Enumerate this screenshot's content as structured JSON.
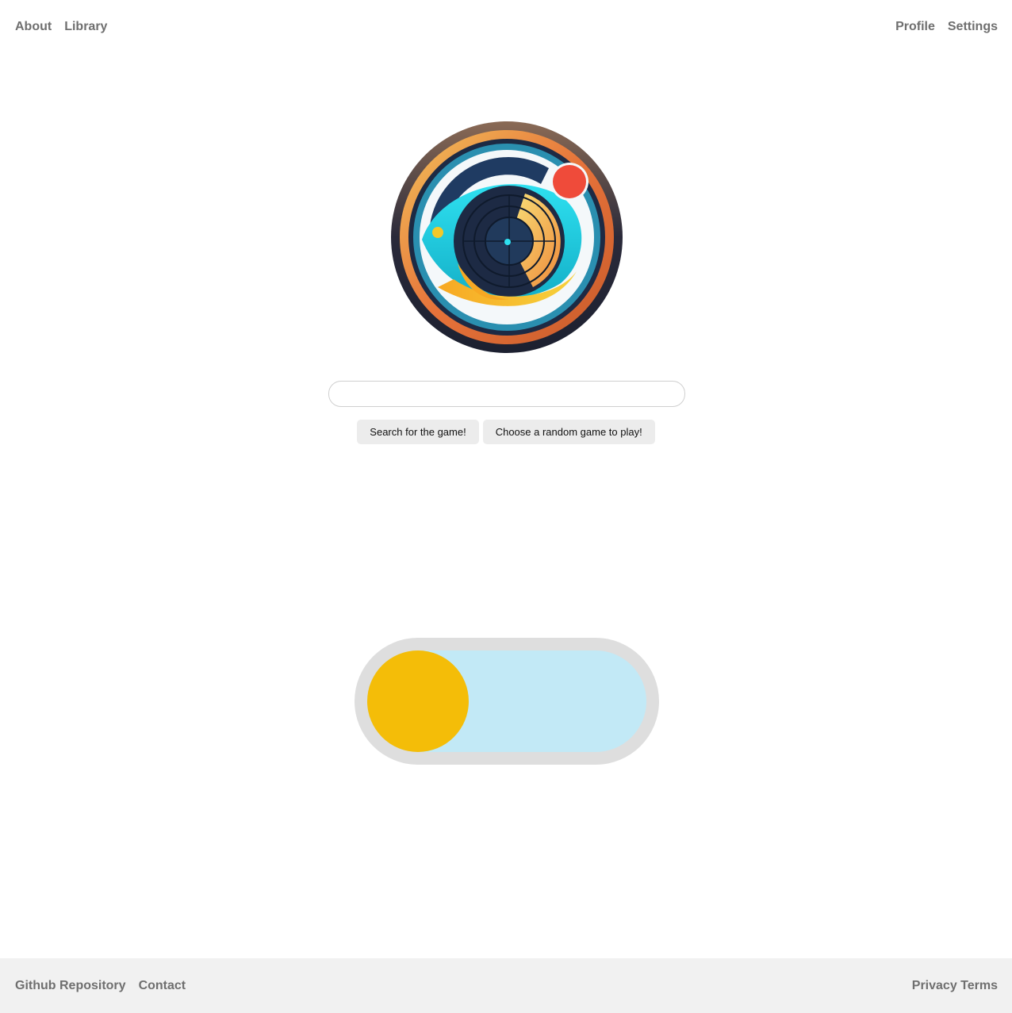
{
  "nav": {
    "left": [
      "About",
      "Library"
    ],
    "right": [
      "Profile",
      "Settings"
    ]
  },
  "logo": {
    "icon": "fish-target-logo"
  },
  "search": {
    "value": "",
    "placeholder": ""
  },
  "buttons": {
    "search_label": "Search for the game!",
    "random_label": "Choose a random game to play!"
  },
  "toggle": {
    "state": "off",
    "colors": {
      "frame": "#dedede",
      "track": "#c2e9f6",
      "knob": "#f4bd08"
    }
  },
  "footer": {
    "left": [
      "Github Repository",
      "Contact"
    ],
    "right": [
      "Privacy Terms"
    ]
  }
}
